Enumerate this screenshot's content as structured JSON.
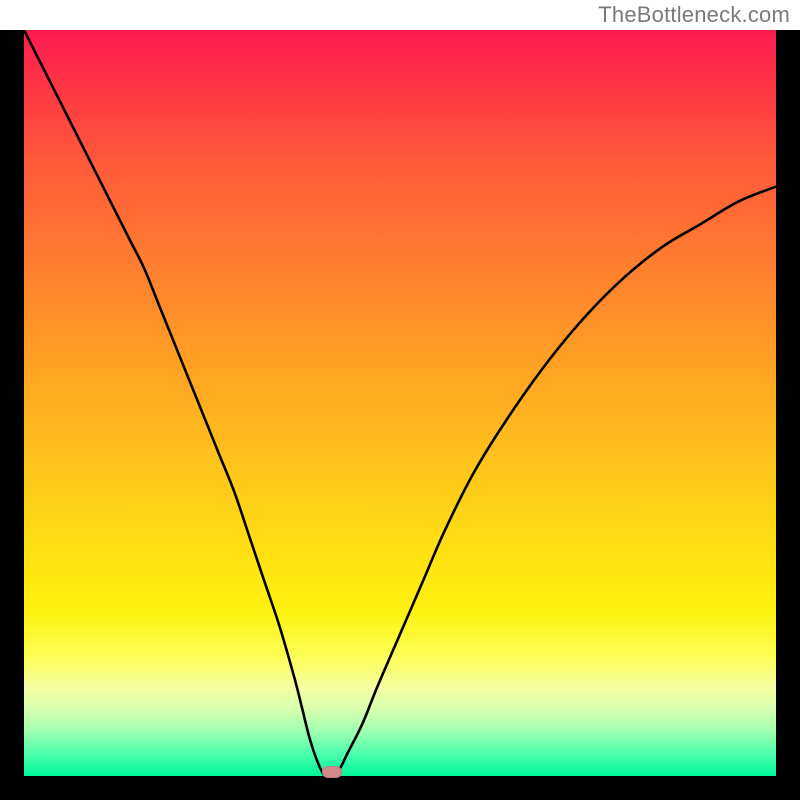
{
  "watermark": "TheBottleneck.com",
  "chart_data": {
    "type": "line",
    "title": "",
    "xlabel": "",
    "ylabel": "",
    "xlim": [
      0,
      100
    ],
    "ylim": [
      0,
      100
    ],
    "grid": false,
    "legend": false,
    "x": [
      0,
      2,
      4,
      6,
      8,
      10,
      12,
      14,
      16,
      18,
      20,
      22,
      24,
      26,
      28,
      30,
      32,
      34,
      36,
      37,
      38,
      39,
      40,
      41,
      42,
      43,
      45,
      47,
      50,
      53,
      56,
      60,
      65,
      70,
      75,
      80,
      85,
      90,
      95,
      100
    ],
    "values": [
      100,
      96,
      92,
      88,
      84,
      80,
      76,
      72,
      68,
      63,
      58,
      53,
      48,
      43,
      38,
      32,
      26,
      20,
      13,
      9,
      5,
      2,
      0,
      0,
      1,
      3,
      7,
      12,
      19,
      26,
      33,
      41,
      49,
      56,
      62,
      67,
      71,
      74,
      77,
      79
    ],
    "marker": {
      "x": 41,
      "y": 0
    },
    "background_gradient": {
      "top": "#ff1a52",
      "mid": "#ffd716",
      "bottom": "#00f59a"
    }
  }
}
